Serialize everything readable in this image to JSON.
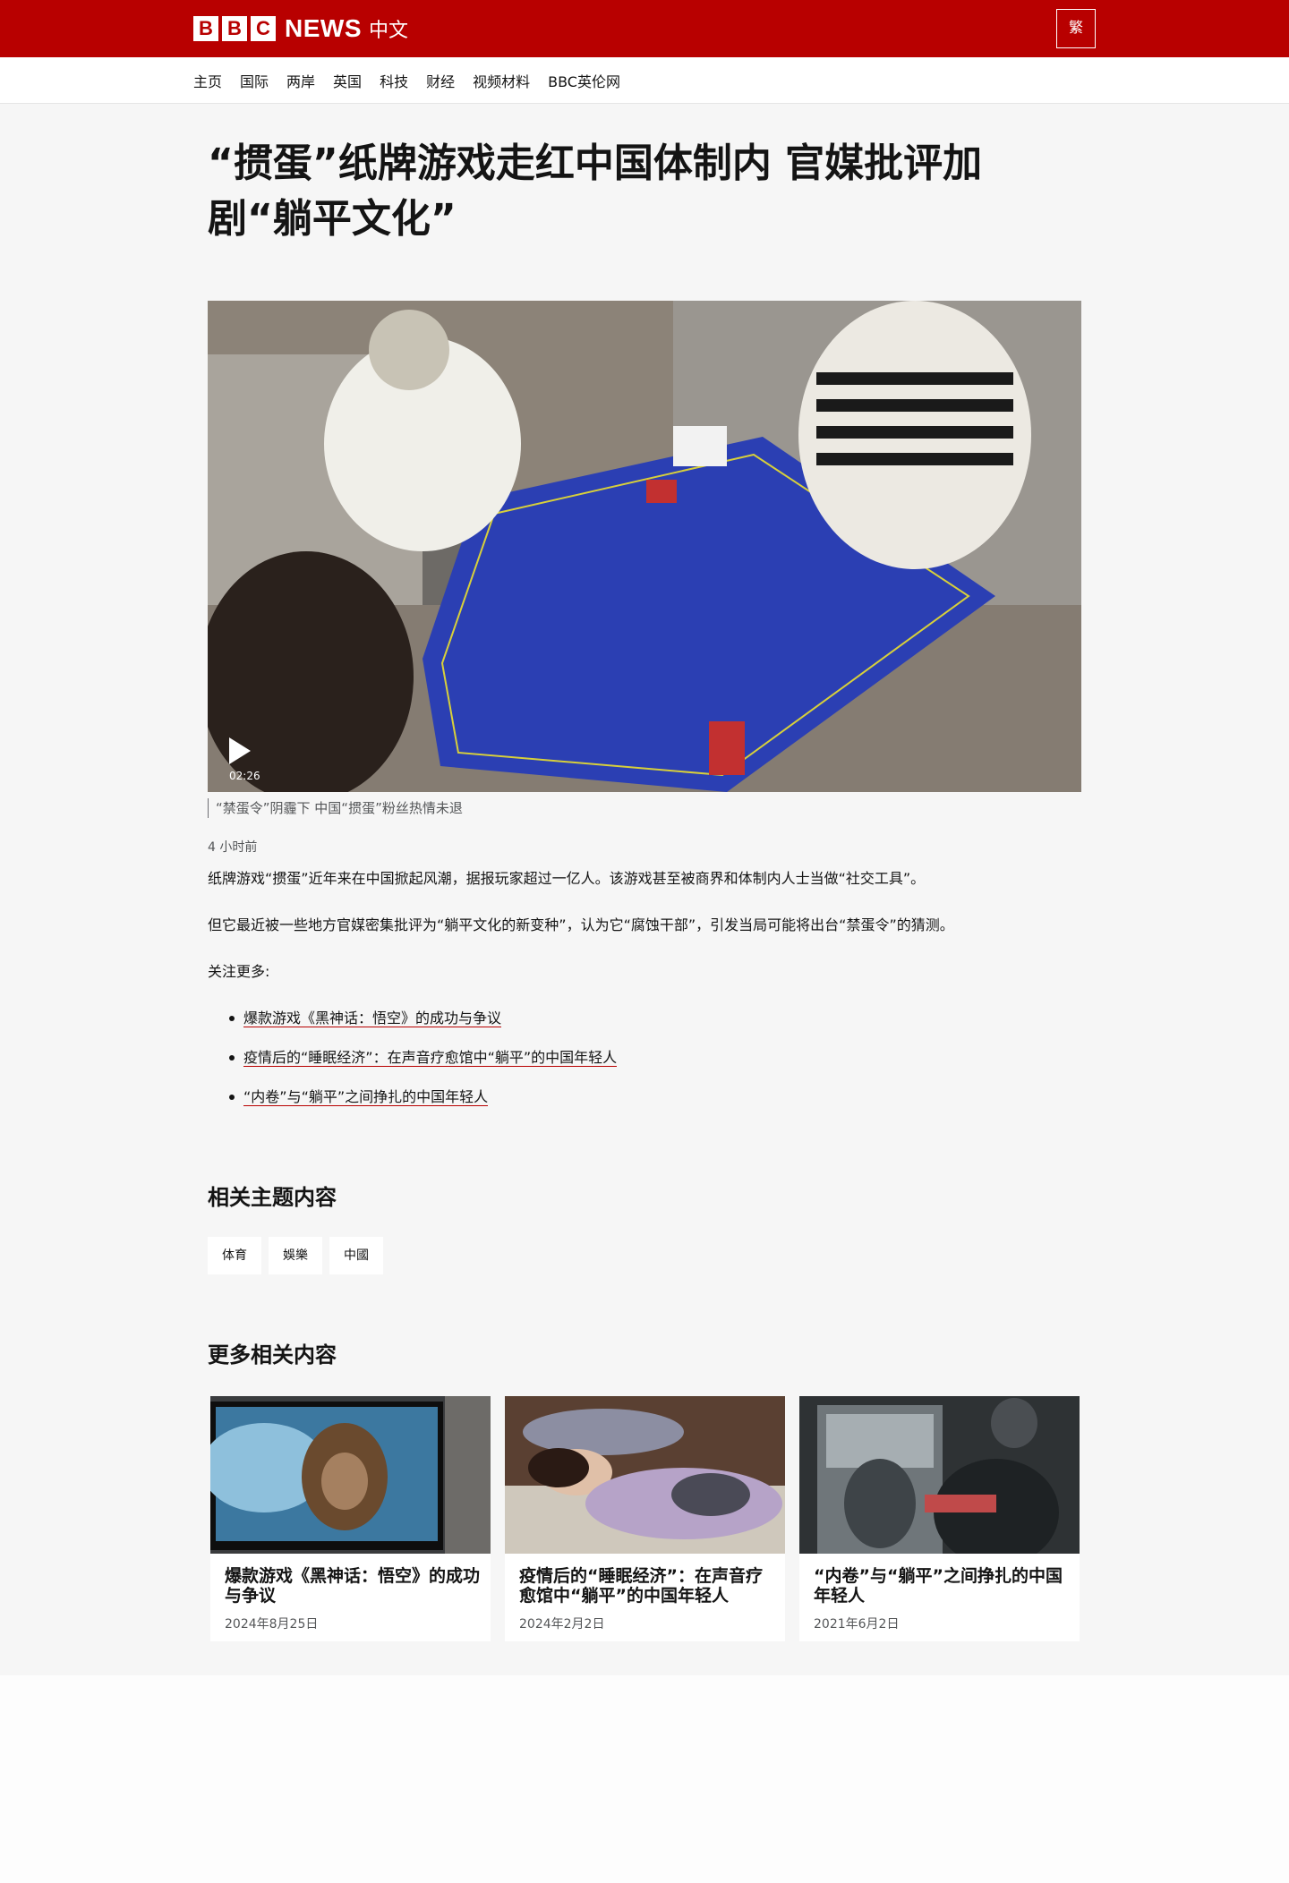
{
  "header": {
    "logo_letters": [
      "B",
      "B",
      "C"
    ],
    "logo_news": "NEWS",
    "logo_zh": "中文",
    "lang_toggle": "繁"
  },
  "nav": {
    "items": [
      "主页",
      "国际",
      "两岸",
      "英国",
      "科技",
      "财经",
      "视频材料",
      "BBC英伦网"
    ]
  },
  "article": {
    "headline": "“掼蛋”纸牌游戏走红中国体制内 官媒批评加剧“躺平文化”",
    "video": {
      "duration": "02:26"
    },
    "caption": "“禁蛋令”阴霾下 中国“掼蛋”粉丝热情未退",
    "time": "4 小时前",
    "paragraphs": [
      "纸牌游戏“掼蛋”近年来在中国掀起风潮，据报玩家超过一亿人。该游戏甚至被商界和体制内人士当做“社交工具”。",
      "但它最近被一些地方官媒密集批评为“躺平文化的新变种”，认为它“腐蚀干部”，引发当局可能将出台“禁蛋令”的猜测。",
      "关注更多:"
    ],
    "links": [
      "爆款游戏《黑神话：悟空》的成功与争议",
      "疫情后的“睡眠经济”：在声音疗愈馆中“躺平”的中国年轻人",
      "“内卷”与“躺平”之间挣扎的中国年轻人"
    ]
  },
  "related_topics": {
    "title": "相关主题内容",
    "tags": [
      "体育",
      "娛樂",
      "中國"
    ]
  },
  "more_related": {
    "title": "更多相关内容",
    "cards": [
      {
        "title": "爆款游戏《黑神话：悟空》的成功与争议",
        "date": "2024年8月25日"
      },
      {
        "title": "疫情后的“睡眠经济”：在声音疗愈馆中“躺平”的中国年轻人",
        "date": "2024年2月2日"
      },
      {
        "title": "“内卷”与“躺平”之间挣扎的中国年轻人",
        "date": "2021年6月2日"
      }
    ]
  },
  "colors": {
    "brand_red": "#b80000",
    "page_bg": "#f6f6f6",
    "text": "#141414"
  }
}
